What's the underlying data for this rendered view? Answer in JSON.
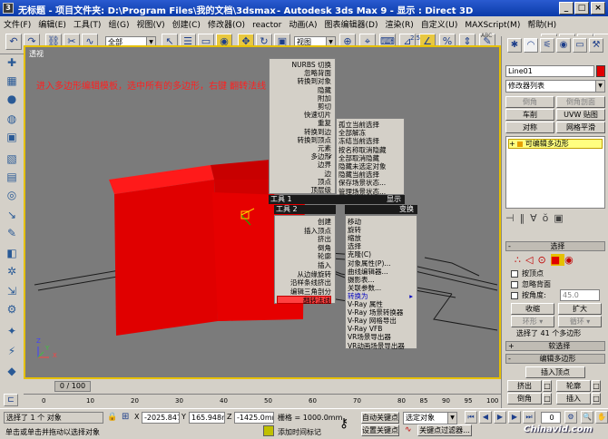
{
  "window": {
    "app_icon": "3",
    "title": "无标题",
    "title_bar_text": "- 项目文件夹: D:\\Program Files\\我的文档\\3dsmax",
    "title_bar_text2": "- Autodesk 3ds Max 9     - 显示 : Direct 3D",
    "min_label": "_",
    "max_label": "□",
    "close_label": "×"
  },
  "menubar": [
    "文件(F)",
    "编辑(E)",
    "工具(T)",
    "组(G)",
    "视图(V)",
    "创建(C)",
    "修改器(O)",
    "reactor",
    "动画(A)",
    "图表编辑器(D)",
    "渲染(R)",
    "自定义(U)",
    "MAXScript(M)",
    "帮助(H)"
  ],
  "toolbar": {
    "selection_filter": "全部",
    "ref_coord": "视图",
    "named_selection": "",
    "angle_snap_value": "2.5",
    "abc_label": "ABC"
  },
  "viewport": {
    "label": "透视",
    "annotation": "进入多边形编辑模板，选中所有的多边形，右键 翻转法线",
    "axis_x": "X",
    "axis_y": "Y",
    "axis_z": "Z"
  },
  "quad_menu": {
    "top_left_items": [
      "NURBS 切换",
      "忽略背面",
      "转换到对象",
      "隐藏",
      "附加",
      "剪切",
      "快速切片",
      "重复",
      "转换到边",
      "转换到顶点",
      "元素",
      "多边形",
      "边界",
      "边",
      "顶点",
      "顶层级"
    ],
    "checked_item": "多边形",
    "checkmark": "✓",
    "top_right_items": [
      "孤立当前选择",
      "全部解冻",
      "冻结当前选择",
      "按名称取消隐藏",
      "全部取消隐藏",
      "隐藏未选定对象",
      "隐藏当前选择",
      "保存场景状态...",
      "管理场景状态..."
    ],
    "tools1_header": "工具 1",
    "display_header": "显示",
    "tools2_header": "工具 2",
    "transform_header": "变换",
    "bottom_left_items": [
      "创建",
      "插入顶点",
      "挤出",
      "倒角",
      "轮廓",
      "插入",
      "从边缘旋转",
      "沿样条线挤出",
      "编辑三角剖分",
      "翻转法线"
    ],
    "highlighted_item": "翻转法线",
    "bottom_right_items": [
      "移动",
      "旋转",
      "缩放",
      "选择",
      "克隆(C)",
      "对象属性(P)...",
      "曲线编辑器...",
      "摄影表...",
      "关联参数...",
      "转换为",
      "V-Ray 属性",
      "V-Ray 场景转换器",
      "V-Ray 网格导出",
      "V-Ray VFB",
      "VR场景导出器",
      "VR动画场景导出器"
    ],
    "submenu_item": "转换为",
    "submenu_arrow": "▸"
  },
  "command_panel": {
    "object_name": "Line01",
    "modifier_list": "修改器列表",
    "buttons_row1": [
      "倒角",
      "倒角剖面"
    ],
    "buttons_row2": [
      "车削",
      "UVW 贴图"
    ],
    "buttons_row3": [
      "对称",
      "网格平滑"
    ],
    "stack_item": "可编辑多边形",
    "stack_item_toggle": "+",
    "selection_rollout": "选择",
    "minus_sign": "-",
    "plus_sign": "+",
    "by_vertex": "按顶点",
    "ignore_backface": "忽略背面",
    "by_angle": "按角度:",
    "angle_value": "45.0",
    "shrink": "收缩",
    "grow": "扩大",
    "ring": "环形",
    "loop": "循环",
    "selected_info": "选择了 41 个多边形",
    "soft_selection_rollout": "软选择",
    "edit_polygons_rollout": "编辑多边形",
    "insert_vertex": "插入顶点",
    "extrude": "挤出",
    "outline": "轮廓",
    "bevel": "倒角",
    "inset": "插入",
    "settings_glyph": "□",
    "dropdown_arrow": "▾"
  },
  "timeline": {
    "frame_label": "0 / 100",
    "ticks": [
      "0",
      "10",
      "20",
      "30",
      "40",
      "50",
      "60",
      "70",
      "80",
      "85",
      "90",
      "95",
      "100"
    ]
  },
  "statusbar": {
    "selected_text": "选择了 1 个 对象",
    "prompt_text": "单击或单击并拖动以选择对象",
    "lock_icon": "🔒",
    "x_label": "X",
    "x_value": "-2025.847",
    "y_label": "Y",
    "y_value": "165.948m",
    "z_label": "Z",
    "z_value": "-1425.0mm",
    "grid_label": "栅格 = 1000.0mm",
    "add_time_tag": "添加时间标记",
    "auto_key": "自动关键点",
    "selected_object": "选定对象",
    "set_key": "设置关键点",
    "key_filters": "关键点过滤器...",
    "frame_value": "0"
  },
  "watermark": "Chinavid.com",
  "colors": {
    "accent_title": "#0a3aa8",
    "viewport_bg": "#7b7b7b",
    "object_red": "#e00000",
    "active_border": "#e6c000",
    "annotation": "#ff2020",
    "submenu_blue": "#0000c0"
  }
}
